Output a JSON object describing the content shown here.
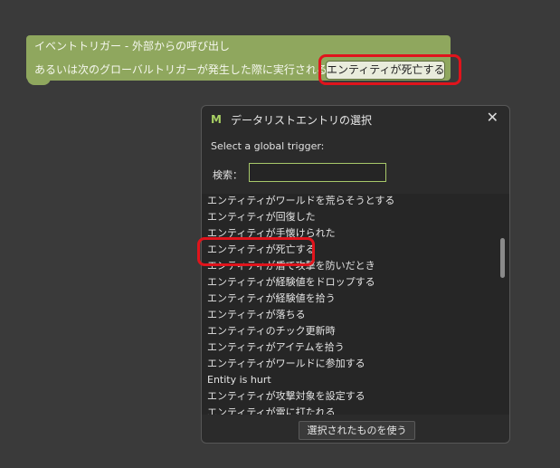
{
  "trigger": {
    "line1": "イベントトリガー - 外部からの呼び出し",
    "line2": "あるいは次のグローバルトリガーが発生した際に実行される",
    "selected_value": "エンティティが死亡する"
  },
  "dialog": {
    "title": "データリストエントリの選択",
    "close_icon": "✕",
    "logo_icon": "mcreator-logo",
    "prompt": "Select a global trigger:",
    "search_label": "検索：",
    "search_value": "",
    "items": [
      "エンティティがワールドを荒らそうとする",
      "エンティティが回復した",
      "エンティティが手懐けられた",
      "エンティティが死亡する",
      "エンティティが盾で攻撃を防いだとき",
      "エンティティが経験値をドロップする",
      "エンティティが経験値を拾う",
      "エンティティが落ちる",
      "エンティティのチック更新時",
      "エンティティがアイテムを拾う",
      "エンティティがワールドに参加する",
      "Entity is hurt",
      "エンティティが攻撃対象を設定する",
      "エンティティが雷に打たれる"
    ],
    "use_button": "選択されたものを使う"
  },
  "colors": {
    "background": "#3a3a3a",
    "block_green": "#8fa75e",
    "highlight_red": "#e0141c",
    "accent": "#a7c86a"
  }
}
